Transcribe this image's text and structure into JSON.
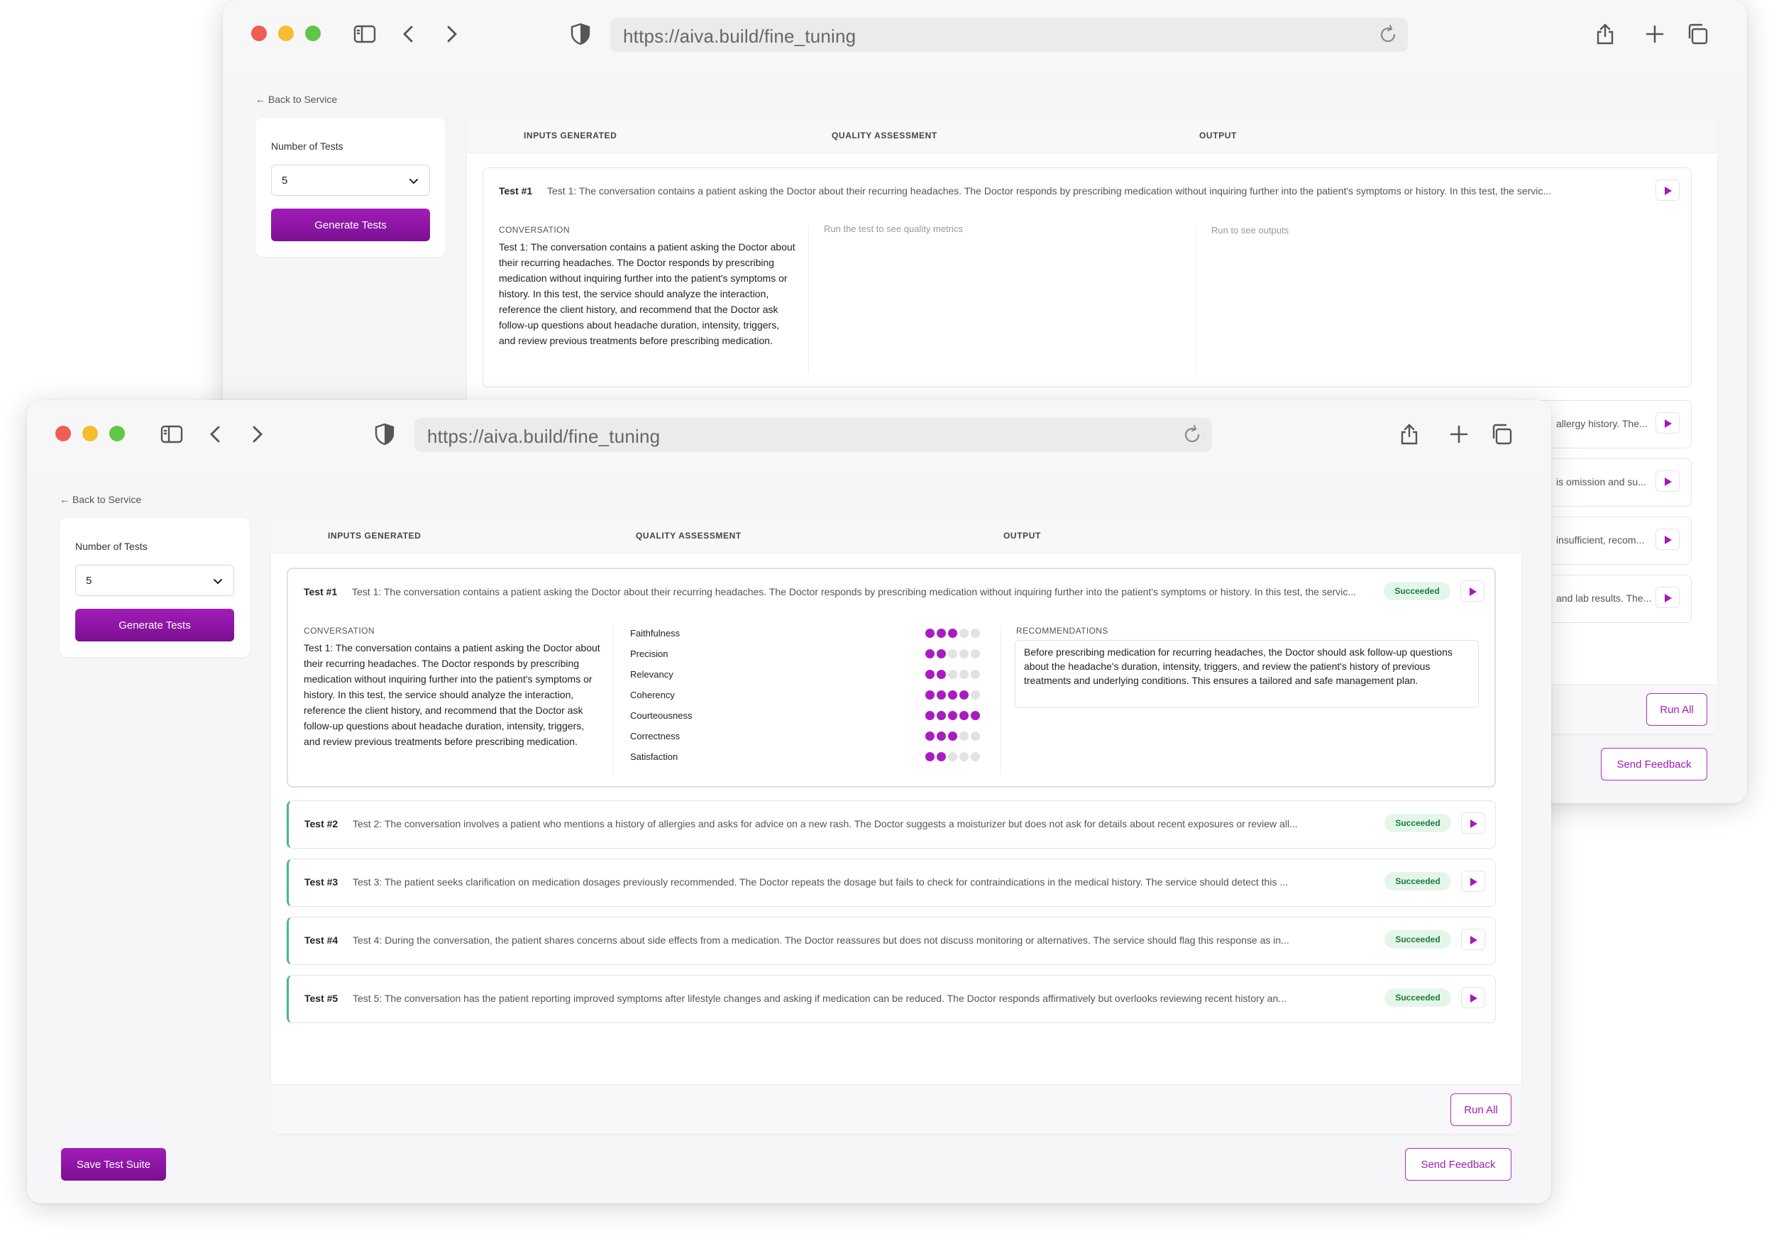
{
  "browser": {
    "url": "https://aiva.build/fine_tuning"
  },
  "page": {
    "back_link": "← Back to Service",
    "number_of_tests_label": "Number of Tests",
    "number_of_tests_value": "5",
    "generate_button": "Generate Tests",
    "run_all_button": "Run All",
    "send_feedback_button": "Send Feedback",
    "save_suite_button": "Save Test Suite"
  },
  "columns": {
    "inputs": "INPUTS GENERATED",
    "quality": "QUALITY ASSESSMENT",
    "output": "OUTPUT"
  },
  "labels": {
    "conversation": "CONVERSATION",
    "recommendations": "RECOMMENDATIONS",
    "quality_placeholder": "Run the test to see quality metrics",
    "output_placeholder": "Run to see outputs"
  },
  "conversation_detail": "Test 1: The conversation contains a patient asking the Doctor about their recurring headaches. The Doctor responds by prescribing medication without inquiring further into the patient's symptoms or history. In this test, the service should analyze the interaction, reference the client history, and recommend that the Doctor ask follow-up questions about headache duration, intensity, triggers, and review previous treatments before prescribing medication.",
  "recommendation": "Before prescribing medication for recurring headaches, the Doctor should ask follow-up questions about the headache's duration, intensity, triggers, and review the patient's history of previous treatments and underlying conditions. This ensures a tailored and safe management plan.",
  "metrics": [
    {
      "name": "Faithfulness",
      "score": 3,
      "max": 5
    },
    {
      "name": "Precision",
      "score": 2,
      "max": 5
    },
    {
      "name": "Relevancy",
      "score": 2,
      "max": 5
    },
    {
      "name": "Coherency",
      "score": 4,
      "max": 5
    },
    {
      "name": "Courteousness",
      "score": 5,
      "max": 5
    },
    {
      "name": "Correctness",
      "score": 3,
      "max": 5
    },
    {
      "name": "Satisfaction",
      "score": 2,
      "max": 5
    }
  ],
  "tests": [
    {
      "num": "Test #1",
      "text": "Test 1: The conversation contains a patient asking the Doctor about their recurring headaches. The Doctor responds by prescribing medication without inquiring further into the patient's symptoms or history. In this test, the servic...",
      "status": "Succeeded"
    },
    {
      "num": "Test #2",
      "text": "Test 2: The conversation involves a patient who mentions a history of allergies and asks for advice on a new rash. The Doctor suggests a moisturizer but does not ask for details about recent exposures or review all...",
      "status": "Succeeded"
    },
    {
      "num": "Test #3",
      "text": "Test 3: The patient seeks clarification on medication dosages previously recommended. The Doctor repeats the dosage but fails to check for contraindications in the medical history. The service should detect this ...",
      "status": "Succeeded"
    },
    {
      "num": "Test #4",
      "text": "Test 4: During the conversation, the patient shares concerns about side effects from a medication. The Doctor reassures but does not discuss monitoring or alternatives. The service should flag this response as in...",
      "status": "Succeeded"
    },
    {
      "num": "Test #5",
      "text": "Test 5: The conversation has the patient reporting improved symptoms after lifestyle changes and asking if medication can be reduced. The Doctor responds affirmatively but overlooks reviewing recent history an...",
      "status": "Succeeded"
    }
  ],
  "back_window_tail": [
    "allergy history. The...",
    "is omission and su...",
    "insufficient, recom...",
    "and lab results. The..."
  ],
  "colors": {
    "accent": "#a21cb8",
    "success_border": "#48b68d",
    "success_badge_bg": "#e4f6ea",
    "success_badge_text": "#1b7a3e"
  }
}
